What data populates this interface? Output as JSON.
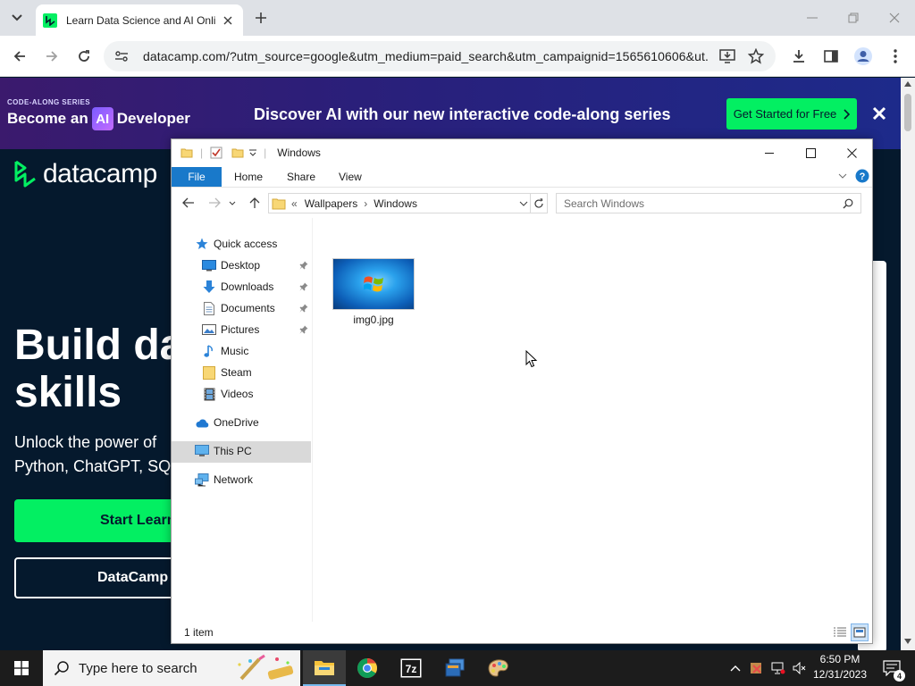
{
  "browser": {
    "tab_title": "Learn Data Science and AI Onli",
    "url": "datacamp.com/?utm_source=google&utm_medium=paid_search&utm_campaignid=1565610606&ut..."
  },
  "page": {
    "promo_tag": "CODE-ALONG SERIES",
    "promo_become": "Become an",
    "promo_ai": "AI",
    "promo_developer": "Developer",
    "promo_headline": "Discover AI with our new interactive code-along series",
    "promo_cta": "Get Started for Free",
    "logo_text": "datacamp",
    "hero_line1": "Build da",
    "hero_line2": "skills",
    "hero_sub1": "Unlock the power of",
    "hero_sub2": "Python, ChatGPT, SQ",
    "cta_primary": "Start Learn",
    "cta_secondary": "DataCamp"
  },
  "explorer": {
    "title": "Windows",
    "ribbon": {
      "file": "File",
      "home": "Home",
      "share": "Share",
      "view": "View"
    },
    "address": {
      "chevrons": "«",
      "crumb1": "Wallpapers",
      "sep": "›",
      "crumb2": "Windows"
    },
    "search_placeholder": "Search Windows",
    "nav": {
      "quick_access": "Quick access",
      "desktop": "Desktop",
      "downloads": "Downloads",
      "documents": "Documents",
      "pictures": "Pictures",
      "music": "Music",
      "steam": "Steam",
      "videos": "Videos",
      "onedrive": "OneDrive",
      "this_pc": "This PC",
      "network": "Network"
    },
    "files": [
      {
        "name": "img0.jpg"
      }
    ],
    "status": "1 item"
  },
  "taskbar": {
    "search_placeholder": "Type here to search",
    "time": "6:50 PM",
    "date": "12/31/2023",
    "notification_count": "4"
  },
  "colors": {
    "datacamp_green": "#03ef62",
    "datacamp_navy": "#05192d",
    "explorer_file_tab": "#1979ca"
  }
}
